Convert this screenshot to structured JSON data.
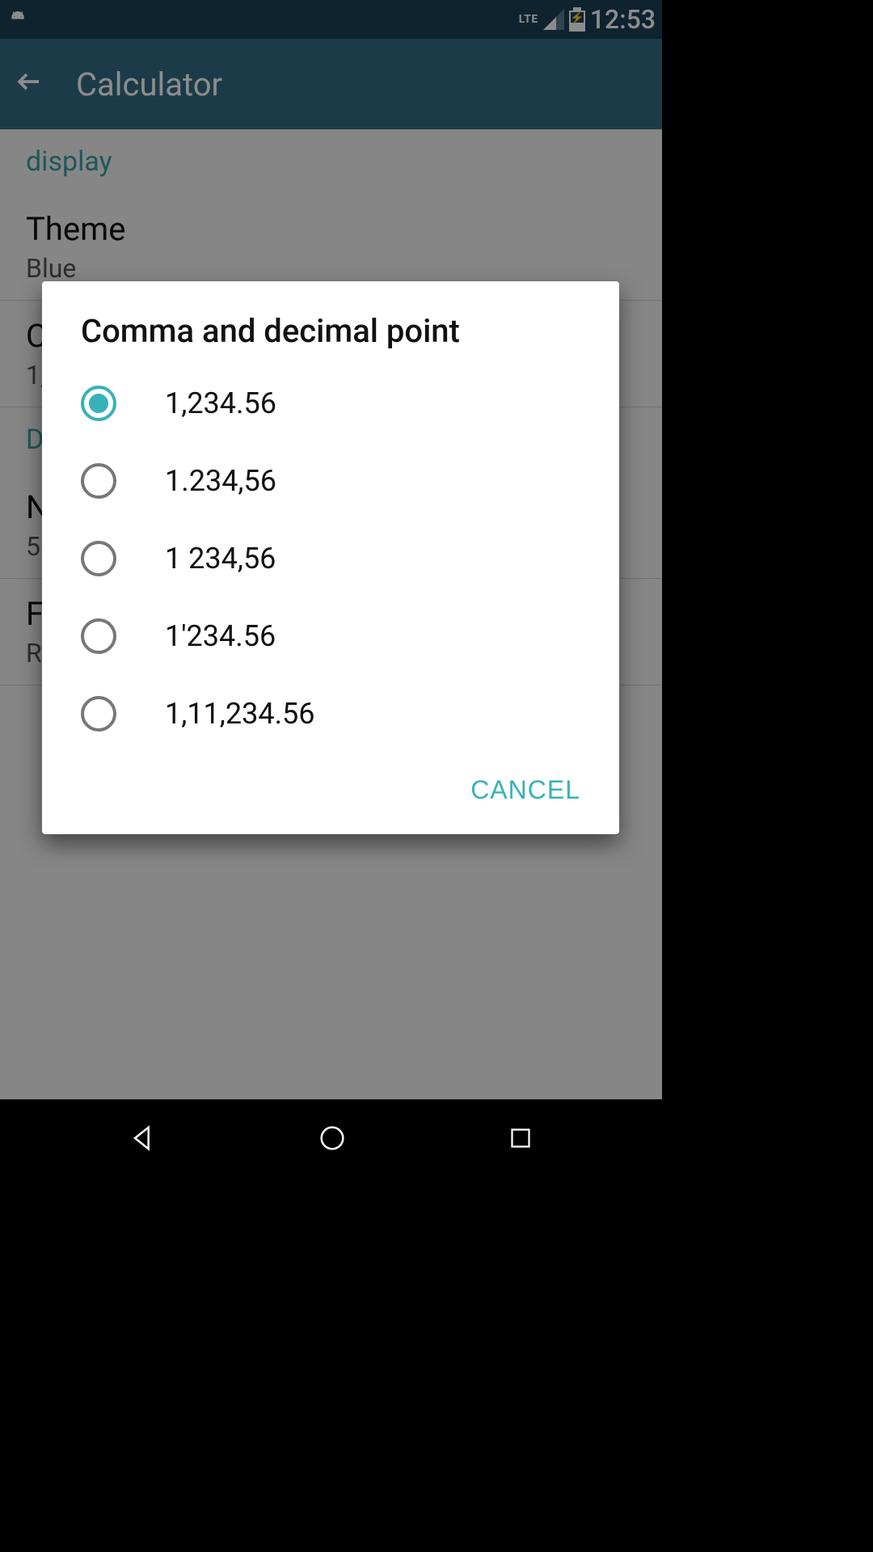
{
  "statusbar": {
    "lte": "LTE",
    "time": "12:53"
  },
  "appbar": {
    "title": "Calculator"
  },
  "background": {
    "display_label": "display",
    "theme_title": "Theme",
    "theme_value": "Blue",
    "row2_title_prefix": "C",
    "row2_sub_prefix": "1,",
    "section_d_prefix": "D",
    "row3_title_prefix": "N",
    "row3_sub_prefix": "5",
    "row4_title_prefix": "F",
    "row4_sub_prefix": "R"
  },
  "dialog": {
    "title": "Comma and decimal point",
    "options": [
      {
        "label": "1,234.56",
        "selected": true
      },
      {
        "label": "1.234,56",
        "selected": false
      },
      {
        "label": "1 234,56",
        "selected": false
      },
      {
        "label": "1'234.56",
        "selected": false
      },
      {
        "label": "1,11,234.56",
        "selected": false
      }
    ],
    "cancel": "CANCEL"
  }
}
